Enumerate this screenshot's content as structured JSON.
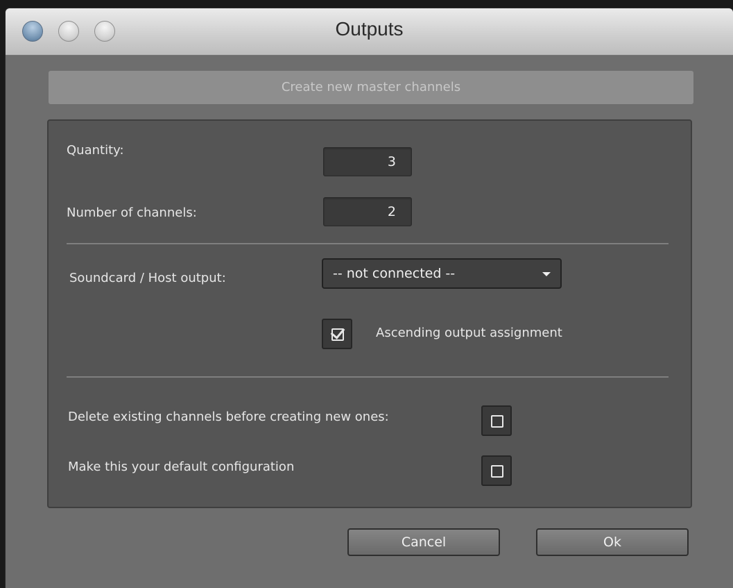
{
  "window": {
    "title": "Outputs"
  },
  "header": {
    "label": "Create new master channels"
  },
  "form": {
    "quantity_label": "Quantity:",
    "quantity_value": "3",
    "channels_label": "Number of channels:",
    "channels_value": "2",
    "output_label": "Soundcard / Host output:",
    "output_selected": "-- not connected --",
    "ascending_label": "Ascending output assignment",
    "ascending_checked": true,
    "delete_label": "Delete existing channels before creating new ones:",
    "delete_checked": false,
    "default_label": "Make this your default configuration",
    "default_checked": false
  },
  "buttons": {
    "cancel": "Cancel",
    "ok": "Ok"
  }
}
